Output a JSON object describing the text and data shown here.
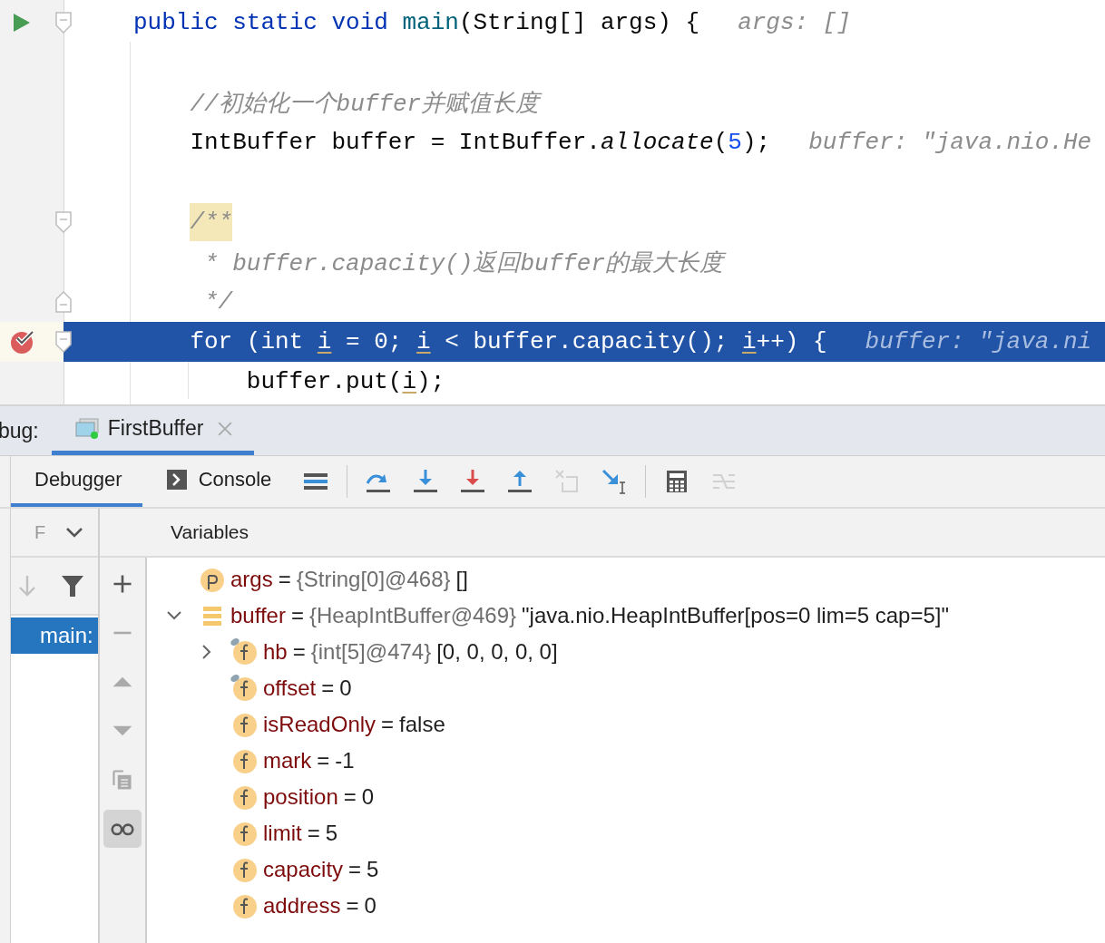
{
  "editor": {
    "lines": [
      {
        "run_marker": true,
        "fold_open": true,
        "selected": false,
        "tokens": [
          {
            "kind": "keyword",
            "text": "public static void "
          },
          {
            "kind": "method",
            "text": "main"
          },
          {
            "kind": "plain",
            "text": "(String[] args) {"
          },
          {
            "kind": "hint",
            "text": "args: []"
          }
        ],
        "children": [
          {
            "selected": false
          },
          {
            "selected": false,
            "tokens": [
              {
                "kind": "comment",
                "text": "//初始化一个buffer并赋值长度"
              }
            ]
          },
          {
            "selected": false,
            "tokens": [
              {
                "kind": "plain",
                "text": "IntBuffer buffer = IntBuffer."
              },
              {
                "kind": "call",
                "text": "allocate"
              },
              {
                "kind": "plain",
                "text": "("
              },
              {
                "kind": "number",
                "text": "5"
              },
              {
                "kind": "plain",
                "text": ");"
              },
              {
                "kind": "hint",
                "text": "buffer: \"java.nio.He"
              }
            ]
          },
          {
            "selected": false
          },
          {
            "fold_open": true,
            "selected": false,
            "tokens": [
              {
                "kind": "doc-match",
                "text": "/**"
              }
            ]
          },
          {
            "selected": false,
            "tokens": [
              {
                "kind": "doc-cont",
                "text": "* buffer.capacity()返回buffer的最大长度"
              }
            ]
          },
          {
            "fold_close": true,
            "selected": false,
            "tokens": [
              {
                "kind": "doc-cont",
                "text": "*/"
              }
            ]
          },
          {
            "breakpoint": true,
            "fold_open": true,
            "selected": true,
            "tokens": [
              {
                "kind": "plain",
                "text": "for (int "
              },
              {
                "kind": "variable",
                "text": "i"
              },
              {
                "kind": "plain",
                "text": " = 0; "
              },
              {
                "kind": "variable",
                "text": "i"
              },
              {
                "kind": "plain",
                "text": " < buffer.capacity(); "
              },
              {
                "kind": "variable",
                "text": "i"
              },
              {
                "kind": "plain",
                "text": "++) {"
              },
              {
                "kind": "hint",
                "text": "buffer: \"java.ni"
              }
            ],
            "children": [
              {
                "selected": false,
                "tokens": [
                  {
                    "kind": "plain",
                    "text": "buffer.put("
                  },
                  {
                    "kind": "variable",
                    "text": "i"
                  },
                  {
                    "kind": "plain",
                    "text": ");"
                  }
                ]
              }
            ]
          }
        ]
      }
    ]
  },
  "debug": {
    "label": "bug:",
    "session_tab": {
      "label": "FirstBuffer",
      "selected": true
    },
    "tabs": [
      {
        "label": "Debugger",
        "kind": "debugger",
        "selected": true
      },
      {
        "label": "Console",
        "kind": "console",
        "selected": false
      }
    ],
    "toolbar": [
      {
        "kind": "threads",
        "disabled": false
      },
      {
        "kind": "step-over",
        "disabled": false
      },
      {
        "kind": "step-into",
        "disabled": false
      },
      {
        "kind": "force-step-into",
        "disabled": false
      },
      {
        "kind": "step-out",
        "disabled": false
      },
      {
        "kind": "drop-frame",
        "disabled": true
      },
      {
        "kind": "run-to-cursor",
        "disabled": false
      },
      {
        "kind": "evaluate",
        "disabled": false
      },
      {
        "kind": "trace",
        "disabled": true
      }
    ],
    "frames": {
      "header": "F",
      "toolbar": [
        {
          "kind": "down",
          "disabled": true
        },
        {
          "kind": "filter",
          "disabled": false
        }
      ],
      "items": [
        {
          "label": "main:",
          "selected": true
        }
      ]
    },
    "side_toolbar": [
      {
        "kind": "add",
        "disabled": false,
        "on": false
      },
      {
        "kind": "remove",
        "disabled": true,
        "on": false
      },
      {
        "kind": "up",
        "disabled": true,
        "on": false
      },
      {
        "kind": "down",
        "disabled": true,
        "on": false
      },
      {
        "kind": "copy",
        "disabled": true,
        "on": false
      },
      {
        "kind": "glasses",
        "disabled": false,
        "on": true
      }
    ],
    "variables": {
      "title": "Variables",
      "items": [
        {
          "kind": "p",
          "name": "args",
          "equals": "=",
          "ref": "{String[0]@468}",
          "value": "[]"
        },
        {
          "kind": "object",
          "name": "buffer",
          "equals": "=",
          "ref": "{HeapIntBuffer@469}",
          "value": "\"java.nio.HeapIntBuffer[pos=0 lim=5 cap=5]\"",
          "expanded": true,
          "children": [
            {
              "kind": "f",
              "name": "hb",
              "equals": "=",
              "ref": "{int[5]@474}",
              "value": "[0, 0, 0, 0, 0]",
              "watched": true,
              "expanded": false
            },
            {
              "kind": "f",
              "name": "offset",
              "equals": "=",
              "value": "0",
              "watched": true
            },
            {
              "kind": "f",
              "name": "isReadOnly",
              "equals": "=",
              "value": "false"
            },
            {
              "kind": "f",
              "name": "mark",
              "equals": "=",
              "value": "-1"
            },
            {
              "kind": "f",
              "name": "position",
              "equals": "=",
              "value": "0"
            },
            {
              "kind": "f",
              "name": "limit",
              "equals": "=",
              "value": "5"
            },
            {
              "kind": "f",
              "name": "capacity",
              "equals": "=",
              "value": "5"
            },
            {
              "kind": "f",
              "name": "address",
              "equals": "=",
              "value": "0"
            }
          ]
        }
      ]
    }
  }
}
